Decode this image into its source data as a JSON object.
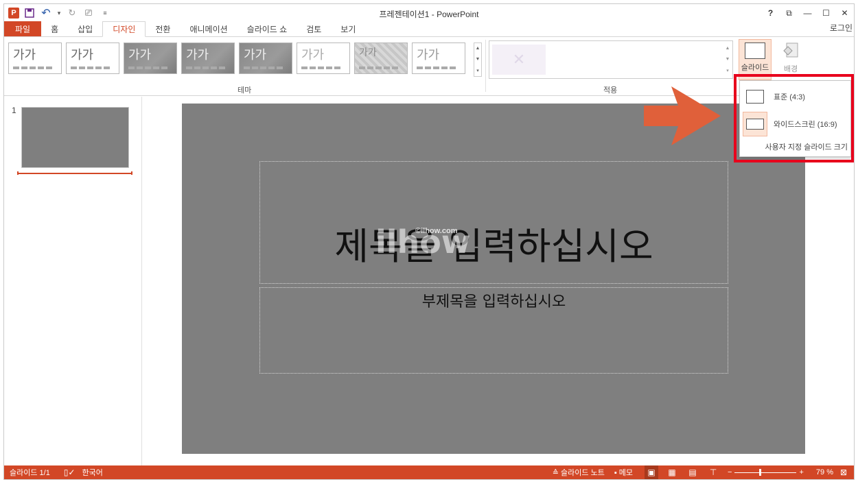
{
  "window": {
    "title": "프레젠테이션1 - PowerPoint",
    "help": "?",
    "restore_ribbon": "⧉",
    "minimize": "—",
    "maximize": "☐",
    "close": "✕"
  },
  "qat": {
    "logo": "P",
    "save": "💾",
    "undo": "↶",
    "undo_more": "▾",
    "redo": "↻",
    "present": "⎚",
    "customize": "≡"
  },
  "tabs": [
    {
      "label": "파일",
      "key": "file"
    },
    {
      "label": "홈",
      "key": "home"
    },
    {
      "label": "삽입",
      "key": "insert"
    },
    {
      "label": "디자인",
      "key": "design"
    },
    {
      "label": "전환",
      "key": "transitions"
    },
    {
      "label": "애니메이션",
      "key": "animations"
    },
    {
      "label": "슬라이드 쇼",
      "key": "slideshow"
    },
    {
      "label": "검토",
      "key": "review"
    },
    {
      "label": "보기",
      "key": "view"
    }
  ],
  "signin": "로그인",
  "ribbon": {
    "theme_text": "가가",
    "theme_group_label": "테마",
    "variants_group_label": "적용",
    "slide_size_label": "슬라이드",
    "background_label": "배경",
    "variant_icon": "✕",
    "scroll_up": "▲",
    "scroll_down": "▼",
    "scroll_more": "▾"
  },
  "dropdown": {
    "standard": "표준 (4:3)",
    "widescreen": "와이드스크린 (16:9)",
    "custom": "사용자 지정 슬라이드 크기"
  },
  "thumbnail": {
    "number": "1"
  },
  "slide": {
    "title_placeholder": "제목을 입력하십시오",
    "subtitle_placeholder": "부제목을 입력하십시오",
    "watermark": "ilhow",
    "watermark_url": "©ilhow.com"
  },
  "status": {
    "slide_count": "슬라이드 1/1",
    "spell_icon": "▯✓",
    "language": "한국어",
    "notes": "≙ 슬라이드 노트",
    "comments": "▪ 메모",
    "view_normal": "▣",
    "view_sorter": "▦",
    "view_reading": "▤",
    "view_slideshow": "⊤",
    "zoom_minus": "−",
    "zoom_plus": "+",
    "zoom_level": "79 %",
    "fit": "⊠"
  },
  "colors": {
    "accent": "#d24726",
    "slide_bg": "#7f7f7f",
    "highlight_frame": "#e8001c",
    "callout_arrow": "#e0603a"
  }
}
